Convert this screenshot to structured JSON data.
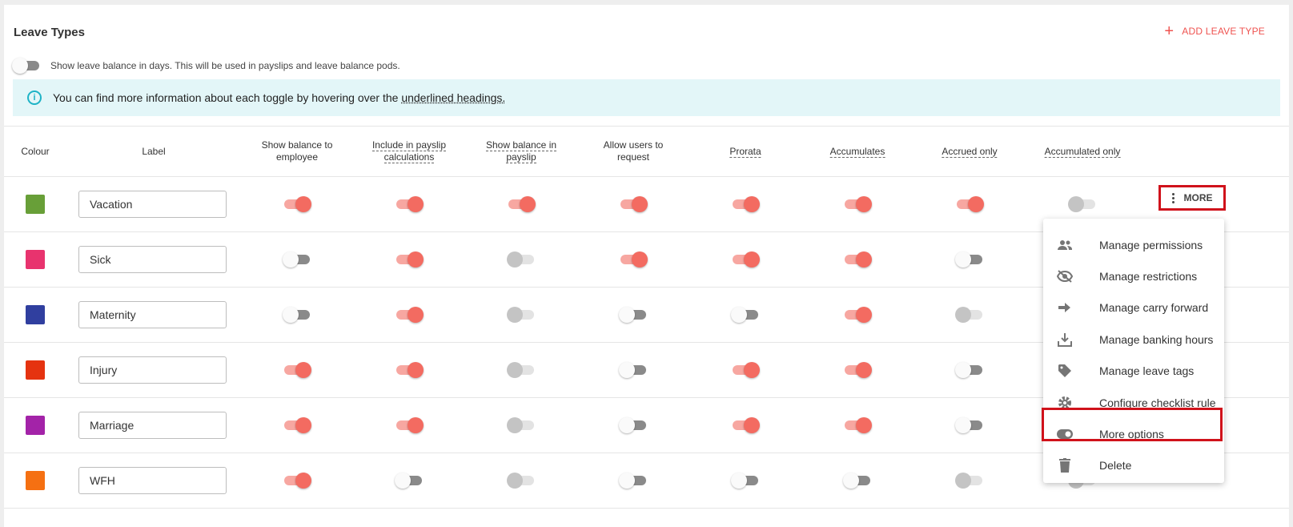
{
  "page": {
    "title": "Leave Types",
    "add_button_label": "ADD LEAVE TYPE",
    "balance_toggle_label": "Show leave balance in days. This will be used in payslips and leave balance pods.",
    "info_text_prefix": "You can find more information about each toggle by hovering over the ",
    "info_text_link": "underlined headings.",
    "more_label": "MORE"
  },
  "columns": {
    "colour": "Colour",
    "label": "Label",
    "show_balance_employee_1": "Show balance to",
    "show_balance_employee_2": "employee",
    "include_payslip_1": "Include in payslip",
    "include_payslip_2": "calculations",
    "show_balance_payslip_1": "Show balance in",
    "show_balance_payslip_2": "payslip",
    "allow_request_1": "Allow users to",
    "allow_request_2": "request",
    "prorata": "Prorata",
    "accumulates": "Accumulates",
    "accrued_only": "Accrued only",
    "accumulated_only": "Accumulated only"
  },
  "rows": [
    {
      "label": "Vacation",
      "colour": "#689f38",
      "toggles": [
        "on",
        "on",
        "on",
        "on",
        "on",
        "on",
        "on",
        "dis"
      ]
    },
    {
      "label": "Sick",
      "colour": "#e8336e",
      "toggles": [
        "off",
        "on",
        "dis",
        "on",
        "on",
        "on",
        "off",
        "dis"
      ]
    },
    {
      "label": "Maternity",
      "colour": "#303f9f",
      "toggles": [
        "off",
        "on",
        "dis",
        "off",
        "off",
        "on",
        "dis",
        "dis"
      ]
    },
    {
      "label": "Injury",
      "colour": "#e53310",
      "toggles": [
        "on",
        "on",
        "dis",
        "off",
        "on",
        "on",
        "off",
        "dis"
      ]
    },
    {
      "label": "Marriage",
      "colour": "#a323a8",
      "toggles": [
        "on",
        "on",
        "dis",
        "off",
        "on",
        "on",
        "off",
        "dis"
      ]
    },
    {
      "label": "WFH",
      "colour": "#f57012",
      "toggles": [
        "on",
        "off",
        "dis",
        "off",
        "off",
        "off",
        "dis",
        "dis"
      ]
    }
  ],
  "menu": {
    "items": [
      {
        "label": "Manage permissions",
        "icon": "people-icon"
      },
      {
        "label": "Manage restrictions",
        "icon": "eye-off-icon"
      },
      {
        "label": "Manage carry forward",
        "icon": "arrow-right-icon"
      },
      {
        "label": "Manage banking hours",
        "icon": "download-icon"
      },
      {
        "label": "Manage leave tags",
        "icon": "tag-icon"
      },
      {
        "label": "Configure checklist rule",
        "icon": "gear-icon"
      },
      {
        "label": "More options",
        "icon": "toggle-icon"
      },
      {
        "label": "Delete",
        "icon": "trash-icon"
      }
    ]
  }
}
